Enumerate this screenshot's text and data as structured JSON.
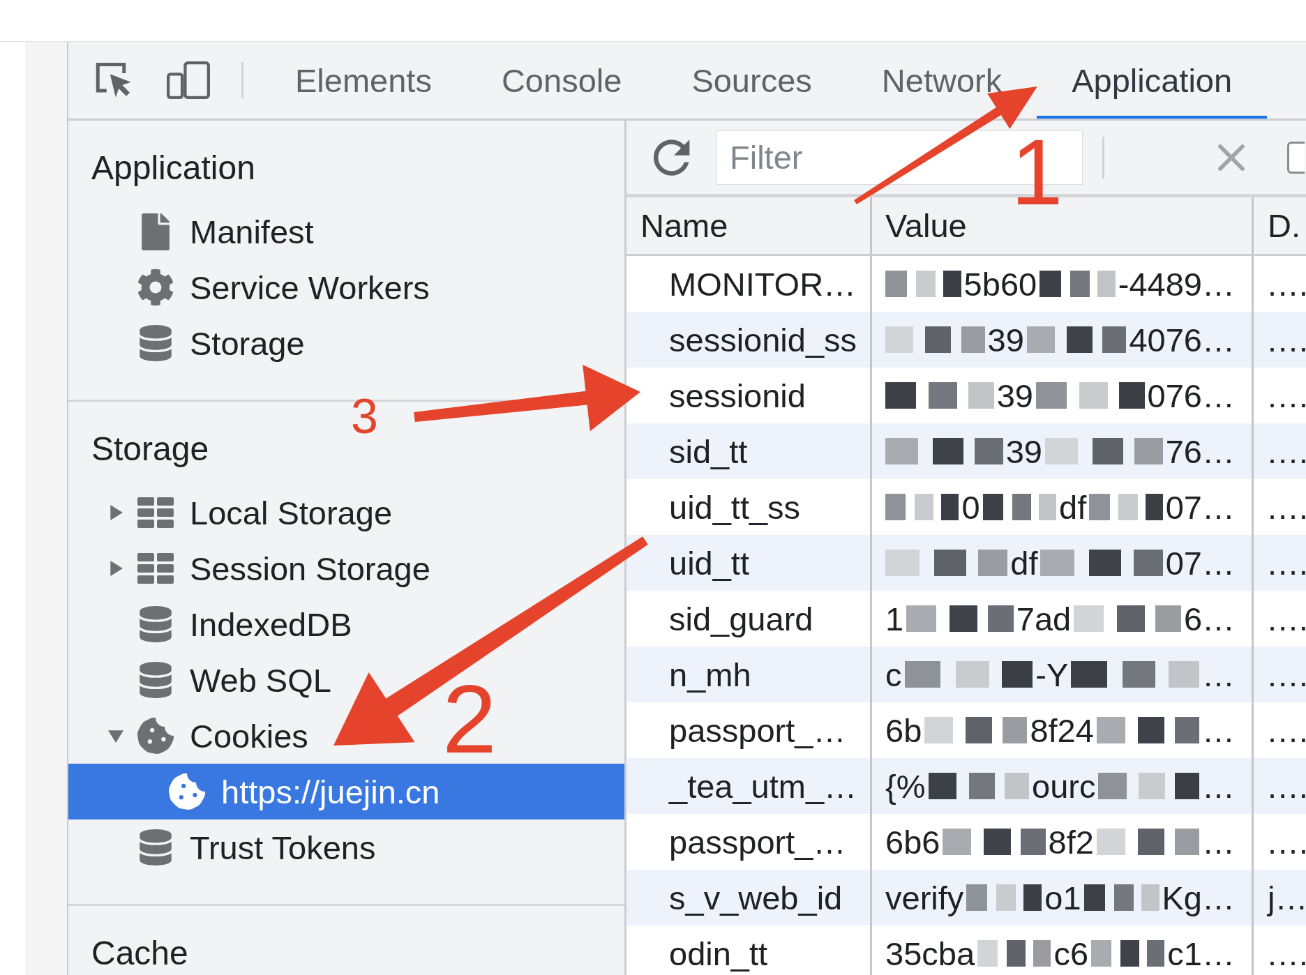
{
  "devtools": {
    "toolbar": {
      "tabs": [
        {
          "label": "Elements",
          "selected": false
        },
        {
          "label": "Console",
          "selected": false
        },
        {
          "label": "Sources",
          "selected": false
        },
        {
          "label": "Network",
          "selected": false
        },
        {
          "label": "Application",
          "selected": true
        }
      ]
    },
    "sidebar": {
      "sections": [
        {
          "title": "Application",
          "items": [
            {
              "label": "Manifest",
              "kind": "file",
              "selected": false
            },
            {
              "label": "Service Workers",
              "kind": "gear",
              "selected": false
            },
            {
              "label": "Storage",
              "kind": "database",
              "selected": false
            }
          ]
        },
        {
          "title": "Storage",
          "items": [
            {
              "label": "Local Storage",
              "kind": "grid",
              "expanded": false,
              "selected": false
            },
            {
              "label": "Session Storage",
              "kind": "grid",
              "expanded": false,
              "selected": false
            },
            {
              "label": "IndexedDB",
              "kind": "database",
              "selected": false
            },
            {
              "label": "Web SQL",
              "kind": "database",
              "selected": false
            },
            {
              "label": "Cookies",
              "kind": "cookie",
              "expanded": true,
              "selected": false,
              "children": [
                {
                  "label": "https://juejin.cn",
                  "kind": "cookie",
                  "selected": true
                }
              ]
            },
            {
              "label": "Trust Tokens",
              "kind": "database",
              "selected": false
            }
          ]
        },
        {
          "title": "Cache"
        }
      ]
    },
    "cookie_panel": {
      "filter": {
        "placeholder": "Filter"
      },
      "checkbox": {
        "checked": false
      },
      "table": {
        "columns": [
          "Name",
          "Value",
          "D."
        ],
        "rows": [
          {
            "name": "MONITOR…",
            "value": [
              {
                "kind": "mask"
              },
              {
                "kind": "text",
                "text": "5b60"
              },
              {
                "kind": "mask"
              },
              {
                "kind": "text",
                "text": "-4489…"
              }
            ],
            "column_3": ".…",
            "selected": false
          },
          {
            "name": "sessionid_ss",
            "value": [
              {
                "kind": "mask"
              },
              {
                "kind": "text",
                "text": "39"
              },
              {
                "kind": "mask"
              },
              {
                "kind": "text",
                "text": "4076…"
              }
            ],
            "column_3": ".…",
            "selected": false
          },
          {
            "name": "sessionid",
            "value": [
              {
                "kind": "mask"
              },
              {
                "kind": "text",
                "text": "39"
              },
              {
                "kind": "mask"
              },
              {
                "kind": "text",
                "text": "076…"
              }
            ],
            "column_3": ".…",
            "selected": false
          },
          {
            "name": "sid_tt",
            "value": [
              {
                "kind": "mask"
              },
              {
                "kind": "text",
                "text": "39"
              },
              {
                "kind": "mask"
              },
              {
                "kind": "text",
                "text": "76…"
              }
            ],
            "column_3": ".…",
            "selected": false
          },
          {
            "name": "uid_tt_ss",
            "value": [
              {
                "kind": "mask"
              },
              {
                "kind": "text",
                "text": "0"
              },
              {
                "kind": "mask"
              },
              {
                "kind": "text",
                "text": "df"
              },
              {
                "kind": "mask"
              },
              {
                "kind": "text",
                "text": "07…"
              }
            ],
            "column_3": ".…",
            "selected": false
          },
          {
            "name": "uid_tt",
            "value": [
              {
                "kind": "mask"
              },
              {
                "kind": "text",
                "text": "df"
              },
              {
                "kind": "mask"
              },
              {
                "kind": "text",
                "text": "07…"
              }
            ],
            "column_3": ".…",
            "selected": false
          },
          {
            "name": "sid_guard",
            "value": [
              {
                "kind": "text",
                "text": "1"
              },
              {
                "kind": "mask"
              },
              {
                "kind": "text",
                "text": "7ad"
              },
              {
                "kind": "mask"
              },
              {
                "kind": "text",
                "text": "6…"
              }
            ],
            "column_3": ".…",
            "selected": false
          },
          {
            "name": "n_mh",
            "value": [
              {
                "kind": "text",
                "text": "c"
              },
              {
                "kind": "mask"
              },
              {
                "kind": "text",
                "text": "-Y"
              },
              {
                "kind": "mask"
              },
              {
                "kind": "text",
                "text": "…"
              }
            ],
            "column_3": ".…",
            "selected": false
          },
          {
            "name": "passport_…",
            "value": [
              {
                "kind": "text",
                "text": "6b"
              },
              {
                "kind": "mask"
              },
              {
                "kind": "text",
                "text": "8f24"
              },
              {
                "kind": "mask"
              },
              {
                "kind": "text",
                "text": "…"
              }
            ],
            "column_3": ".…",
            "selected": false
          },
          {
            "name": "_tea_utm_…",
            "value": [
              {
                "kind": "text",
                "text": "{%"
              },
              {
                "kind": "mask"
              },
              {
                "kind": "text",
                "text": "ourc"
              },
              {
                "kind": "mask"
              },
              {
                "kind": "text",
                "text": "…"
              }
            ],
            "column_3": ".…",
            "selected": false
          },
          {
            "name": "passport_…",
            "value": [
              {
                "kind": "text",
                "text": "6b6"
              },
              {
                "kind": "mask"
              },
              {
                "kind": "text",
                "text": "8f2"
              },
              {
                "kind": "mask"
              },
              {
                "kind": "text",
                "text": "…"
              }
            ],
            "column_3": ".…",
            "selected": false
          },
          {
            "name": "s_v_web_id",
            "value": [
              {
                "kind": "text",
                "text": "verify"
              },
              {
                "kind": "mask"
              },
              {
                "kind": "text",
                "text": "o1"
              },
              {
                "kind": "mask"
              },
              {
                "kind": "text",
                "text": "Kg…"
              }
            ],
            "column_3": "j…",
            "selected": false
          },
          {
            "name": "odin_tt",
            "value": [
              {
                "kind": "text",
                "text": "35cba"
              },
              {
                "kind": "mask"
              },
              {
                "kind": "text",
                "text": "c6"
              },
              {
                "kind": "mask"
              },
              {
                "kind": "text",
                "text": "c1…"
              }
            ],
            "column_3": ".…",
            "selected": false
          }
        ]
      }
    }
  },
  "annotations": [
    {
      "label": "1"
    },
    {
      "label": "2"
    },
    {
      "label": "3"
    }
  ]
}
